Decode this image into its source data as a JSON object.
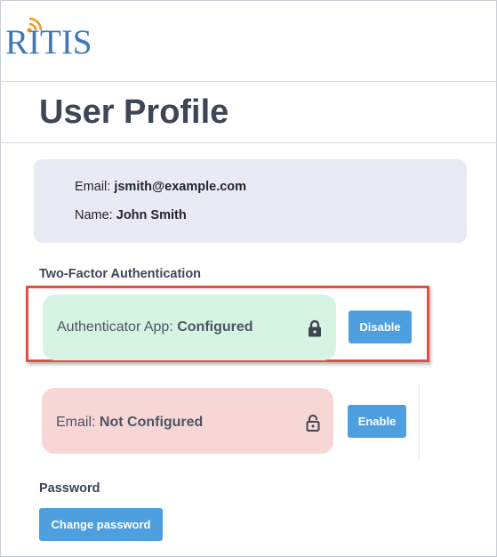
{
  "logo": {
    "text": "RITIS",
    "accent_color": "#f29a1f",
    "brand_color": "#3e78b7"
  },
  "page": {
    "title": "User Profile"
  },
  "user": {
    "email_label": "Email:",
    "email_value": "jsmith@example.com",
    "name_label": "Name:",
    "name_value": "John Smith"
  },
  "two_factor": {
    "heading": "Two-Factor Authentication",
    "methods": [
      {
        "label": "Authenticator App:",
        "status": "Configured",
        "icon": "lock-closed-icon",
        "button_label": "Disable",
        "card_color": "#d5f4e2"
      },
      {
        "label": "Email:",
        "status": "Not Configured",
        "icon": "lock-open-icon",
        "button_label": "Enable",
        "card_color": "#f7d7d6"
      }
    ]
  },
  "password": {
    "heading": "Password",
    "button_label": "Change password"
  },
  "colors": {
    "button": "#4e9fe0",
    "highlight": "#e24f45"
  }
}
